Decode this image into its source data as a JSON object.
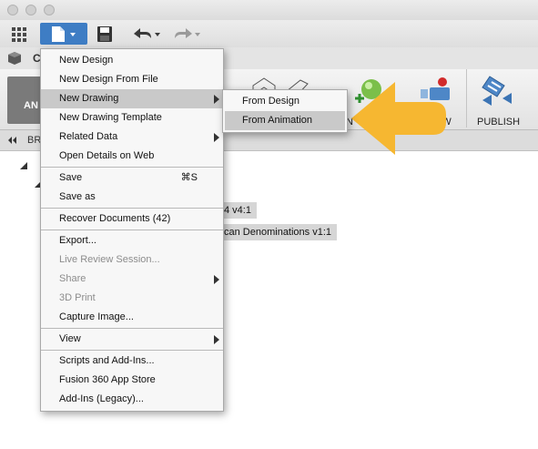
{
  "ribbon": {
    "workspace_partial": "AN",
    "publish_label": "PUBLISH",
    "preview_partial": "EW",
    "insert_partial": "N"
  },
  "row2": {
    "tab_partial": "C"
  },
  "browser": {
    "label_partial": "BR"
  },
  "tree": {
    "item1_partial": "4 v4:1",
    "item2_partial": "can Denominations v1:1"
  },
  "file_menu": {
    "items": [
      {
        "label": "New Design",
        "enabled": true
      },
      {
        "label": "New Design From File",
        "enabled": true
      },
      {
        "label": "New Drawing",
        "enabled": true,
        "submenu": true,
        "highlighted": true
      },
      {
        "label": "New Drawing Template",
        "enabled": true
      },
      {
        "label": "Related Data",
        "enabled": true,
        "submenu": true
      },
      {
        "label": "Open Details on Web",
        "enabled": true
      },
      {
        "label": "Save",
        "enabled": true,
        "shortcut": "⌘S"
      },
      {
        "label": "Save as",
        "enabled": true
      },
      {
        "label": "Recover Documents (42)",
        "enabled": true
      },
      {
        "label": "Export...",
        "enabled": true
      },
      {
        "label": "Live Review Session...",
        "enabled": false
      },
      {
        "label": "Share",
        "enabled": false,
        "submenu": true
      },
      {
        "label": "3D Print",
        "enabled": false
      },
      {
        "label": "Capture Image...",
        "enabled": true
      },
      {
        "label": "View",
        "enabled": true,
        "submenu": true
      },
      {
        "label": "Scripts and Add-Ins...",
        "enabled": true
      },
      {
        "label": "Fusion 360 App Store",
        "enabled": true
      },
      {
        "label": "Add-Ins (Legacy)...",
        "enabled": true
      }
    ]
  },
  "submenu": {
    "items": [
      {
        "label": "From Design",
        "highlighted": false
      },
      {
        "label": "From Animation",
        "highlighted": true
      }
    ]
  },
  "colors": {
    "file_button": "#3e7dc4",
    "callout_arrow": "#f6b731",
    "menu_highlight": "#c9c9c9"
  }
}
